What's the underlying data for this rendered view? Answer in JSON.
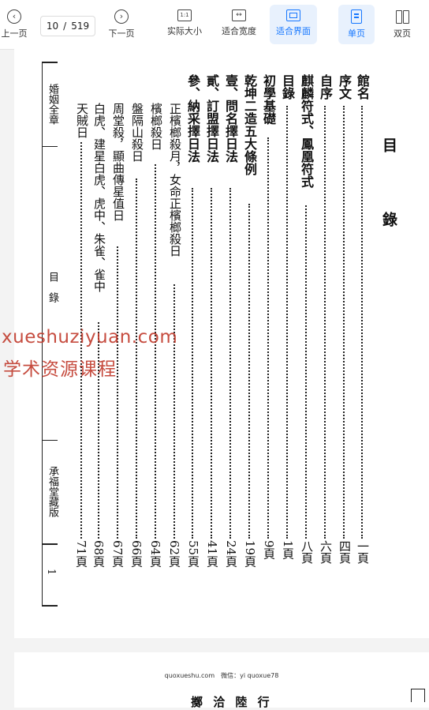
{
  "toolbar": {
    "prev_label": "上一页",
    "page_current": "10",
    "page_sep": "/",
    "page_total": "519",
    "next_label": "下一页",
    "actual_size_label": "实际大小",
    "actual_size_glyph": "1:1",
    "fit_width_label": "适合宽度",
    "fit_page_label": "适合界面",
    "single_page_label": "单页",
    "double_page_label": "双页",
    "accent_color": "#1677ff"
  },
  "document": {
    "title": "目　錄",
    "side_book_title": "婚姻全章",
    "side_section": "目　錄",
    "side_publisher": "承福堂藏版",
    "side_page": "1",
    "entries": [
      {
        "text": "館名",
        "page": "一頁"
      },
      {
        "text": "序文",
        "page": "四頁"
      },
      {
        "text": "自序",
        "page": "六頁"
      },
      {
        "text": "麒麟符式、鳳凰符式",
        "page": "八頁"
      },
      {
        "text": "目錄",
        "page": "1頁"
      },
      {
        "text": "初學基礎",
        "page": "9頁"
      },
      {
        "text": "乾坤二造五大條例",
        "page": "19頁"
      },
      {
        "text": "壹、問名擇日法",
        "page": "24頁"
      },
      {
        "text": "貳、訂盟擇日法",
        "page": "41頁"
      },
      {
        "text": "參、納采擇日法",
        "page": "55頁"
      },
      {
        "text": "正檳榔殺月，女命正檳榔殺日",
        "page": "62頁"
      },
      {
        "text": "檳榔殺日",
        "page": "64頁"
      },
      {
        "text": "盤隔山殺日",
        "page": "66頁"
      },
      {
        "text": "周堂殺，顯曲傳星值日",
        "page": "67頁"
      },
      {
        "text": "白虎、建星白虎、虎中、朱雀、雀中",
        "page": "68頁"
      },
      {
        "text": "天賊日",
        "page": "71頁"
      }
    ]
  },
  "watermark": {
    "line1": "xueshuziyuan.com",
    "line2": "学术资源课程"
  },
  "next_page": {
    "footer": "quoxueshu.com　微信：yi quoxue78",
    "heading_partial": "擲 洽 陸 行"
  }
}
